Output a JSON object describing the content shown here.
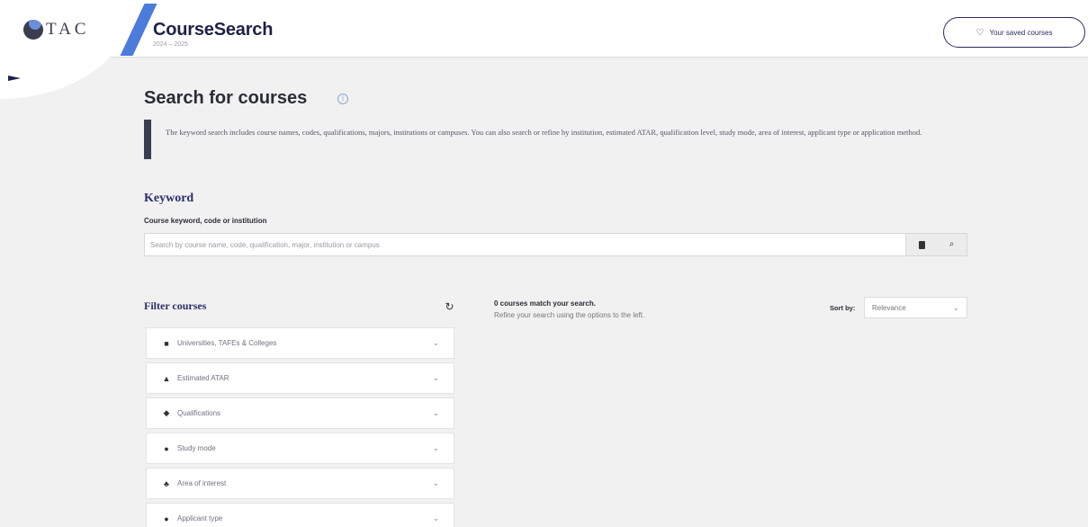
{
  "colors": {
    "brand_dark": "#1f2147",
    "accent_blue": "#4c7bd9",
    "page_bg": "#f1f1f1"
  },
  "header": {
    "logo_text": "TAC",
    "brand_title": "CourseSearch",
    "brand_subtitle": "2024 – 2025",
    "saved_button_label": "Your saved courses",
    "saved_button_icon": "heart-outline-icon"
  },
  "main": {
    "page_title": "Search for courses",
    "intro_text": "The keyword search includes course names, codes, qualifications, majors, institutions or campuses. You can also search or refine by institution, estimated ATAR, qualification level, study mode, area of interest, applicant type or application method."
  },
  "keyword": {
    "section_title": "Keyword",
    "field_label": "Course keyword, code or institution",
    "placeholder": "Search by course name, code, qualification, major, institution or campus",
    "value": ""
  },
  "filters": {
    "title": "Filter courses",
    "items": [
      {
        "label": "Universities, TAFEs & Colleges",
        "icon": "building-icon"
      },
      {
        "label": "Estimated ATAR",
        "icon": "shapes-icon"
      },
      {
        "label": "Qualifications",
        "icon": "graduation-cap-icon"
      },
      {
        "label": "Study mode",
        "icon": "toggle-icon"
      },
      {
        "label": "Area of interest",
        "icon": "sitemap-icon"
      },
      {
        "label": "Applicant type",
        "icon": "user-circle-icon"
      }
    ]
  },
  "results": {
    "count_text": "0 courses match your search.",
    "hint_text": "Refine your search using the options to the left.",
    "sort_label": "Sort by:",
    "sort_value": "Relevance"
  }
}
